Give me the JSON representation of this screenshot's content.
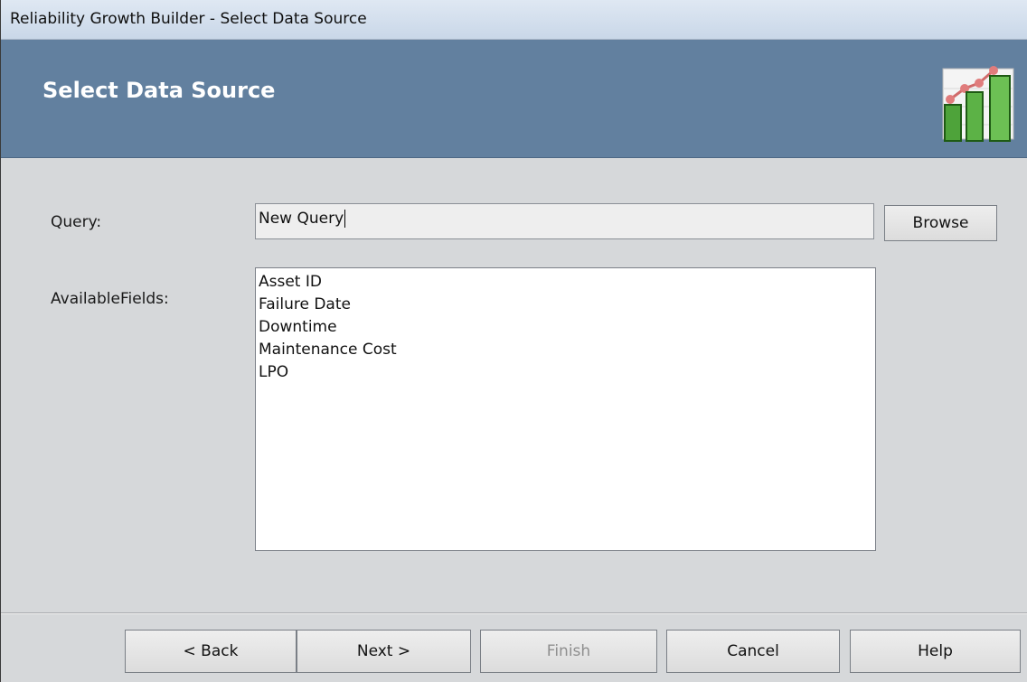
{
  "window": {
    "title": "Reliability Growth Builder - Select Data Source"
  },
  "header": {
    "heading": "Select Data Source",
    "icon": "chart-growth-icon"
  },
  "form": {
    "query_label": "Query:",
    "query_value": "New Query",
    "browse_label": "Browse",
    "fields_label": "AvailableFields:",
    "fields": [
      "Asset ID",
      "Failure Date",
      "Downtime",
      "Maintenance Cost",
      "LPO"
    ]
  },
  "footer": {
    "back_label": "< Back",
    "next_label": "Next >",
    "finish_label": "Finish",
    "cancel_label": "Cancel",
    "help_label": "Help"
  },
  "colors": {
    "header_bg": "#62809f",
    "titlebar_bg": "#c9d7e8",
    "window_bg": "#d6d8da"
  }
}
